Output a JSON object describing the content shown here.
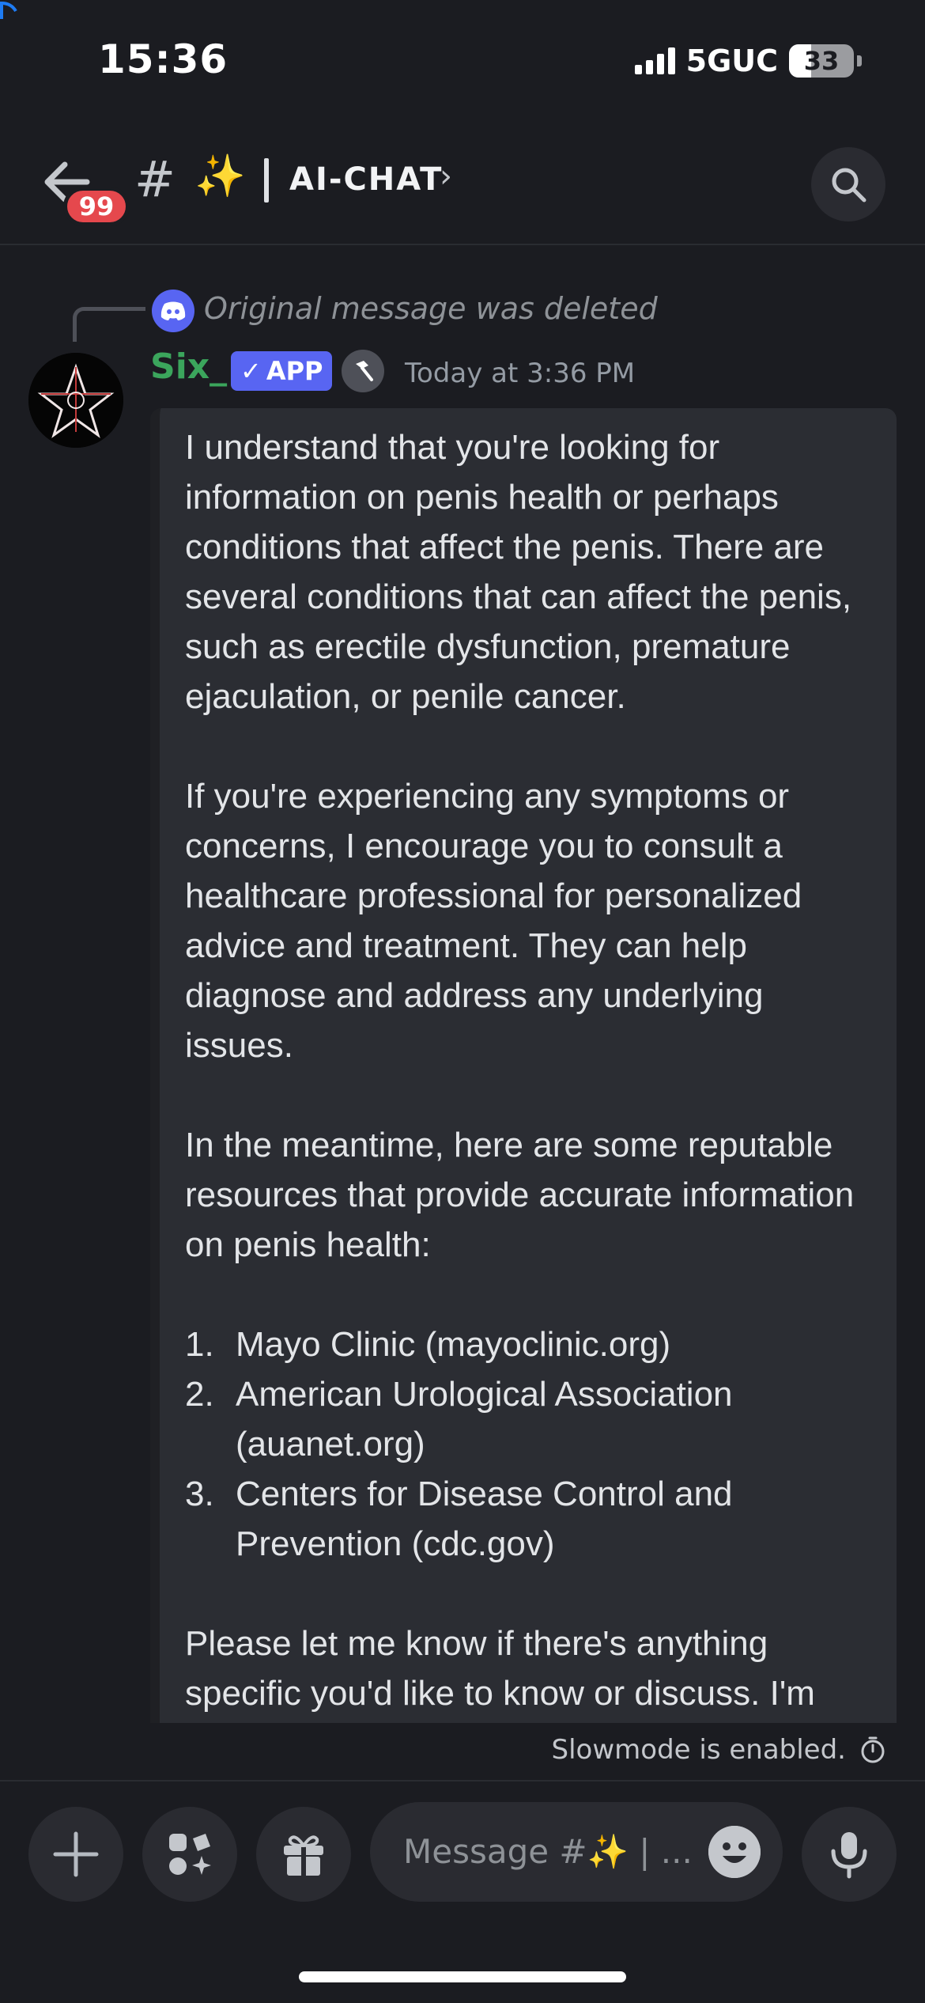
{
  "status_bar": {
    "time": "15:36",
    "network": "5GUC",
    "battery": "33",
    "battery_level": 0.33
  },
  "header": {
    "unread_count": "99",
    "channel_prefix": "#",
    "channel_emoji": "✨",
    "channel_name": "AI-CHAT",
    "chevron": "›"
  },
  "message": {
    "reply_text": "Original message was deleted",
    "author": "Six_",
    "app_badge": "APP",
    "timestamp": "Today at 3:36 PM",
    "paragraph_1": "I understand that you're looking for information on penis health or perhaps conditions that affect the penis. There are several conditions that can affect the penis, such as erectile dysfunction, premature ejaculation, or penile cancer.",
    "paragraph_2": "If you're experiencing any symptoms or concerns, I encourage you to consult a healthcare professional for personalized advice and treatment. They can help diagnose and address any underlying issues.",
    "paragraph_3": "In the meantime, here are some reputable resources that provide accurate information on penis health:",
    "resources": [
      {
        "num": "1.",
        "text": "Mayo Clinic (mayoclinic.org)"
      },
      {
        "num": "2.",
        "text": "American Urological Association (auanet.org)"
      },
      {
        "num": "3.",
        "text": "Centers for Disease Control and Prevention (cdc.gov)"
      }
    ],
    "paragraph_4": "Please let me know if there's anything specific you'd like to know or discuss. I'm"
  },
  "slowmode": {
    "text": "Slowmode is enabled."
  },
  "composer": {
    "placeholder": "Message #✨ | ..."
  },
  "colors": {
    "background": "#1b1c21",
    "author_green": "#3ba55c",
    "blurple": "#5865f2",
    "badge_red": "#e5484d"
  },
  "icons": [
    "back-arrow-icon",
    "search-icon",
    "discord-icon",
    "hammer-icon",
    "timer-icon",
    "plus-icon",
    "apps-icon",
    "gift-icon",
    "emoji-icon",
    "microphone-icon"
  ]
}
